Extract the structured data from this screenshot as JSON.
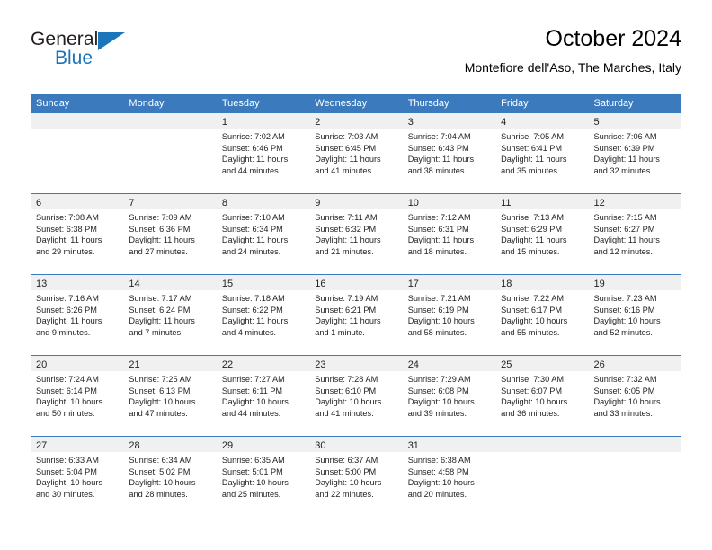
{
  "brand": {
    "name_top": "General",
    "name_bottom": "Blue",
    "triangle_icon": "brand-triangle-icon",
    "color_dark": "#231f20",
    "color_blue": "#1b75bb"
  },
  "header": {
    "title": "October 2024",
    "subtitle": "Montefiore dell'Aso, The Marches, Italy"
  },
  "theme": {
    "header_blue": "#3a7abd",
    "daynum_band": "#f0f0f0",
    "text": "#222222"
  },
  "calendar": {
    "weekday_headers": [
      "Sunday",
      "Monday",
      "Tuesday",
      "Wednesday",
      "Thursday",
      "Friday",
      "Saturday"
    ],
    "weeks": [
      [
        {
          "day": "",
          "lines": []
        },
        {
          "day": "",
          "lines": []
        },
        {
          "day": "1",
          "lines": [
            "Sunrise: 7:02 AM",
            "Sunset: 6:46 PM",
            "Daylight: 11 hours",
            "and 44 minutes."
          ]
        },
        {
          "day": "2",
          "lines": [
            "Sunrise: 7:03 AM",
            "Sunset: 6:45 PM",
            "Daylight: 11 hours",
            "and 41 minutes."
          ]
        },
        {
          "day": "3",
          "lines": [
            "Sunrise: 7:04 AM",
            "Sunset: 6:43 PM",
            "Daylight: 11 hours",
            "and 38 minutes."
          ]
        },
        {
          "day": "4",
          "lines": [
            "Sunrise: 7:05 AM",
            "Sunset: 6:41 PM",
            "Daylight: 11 hours",
            "and 35 minutes."
          ]
        },
        {
          "day": "5",
          "lines": [
            "Sunrise: 7:06 AM",
            "Sunset: 6:39 PM",
            "Daylight: 11 hours",
            "and 32 minutes."
          ]
        }
      ],
      [
        {
          "day": "6",
          "lines": [
            "Sunrise: 7:08 AM",
            "Sunset: 6:38 PM",
            "Daylight: 11 hours",
            "and 29 minutes."
          ]
        },
        {
          "day": "7",
          "lines": [
            "Sunrise: 7:09 AM",
            "Sunset: 6:36 PM",
            "Daylight: 11 hours",
            "and 27 minutes."
          ]
        },
        {
          "day": "8",
          "lines": [
            "Sunrise: 7:10 AM",
            "Sunset: 6:34 PM",
            "Daylight: 11 hours",
            "and 24 minutes."
          ]
        },
        {
          "day": "9",
          "lines": [
            "Sunrise: 7:11 AM",
            "Sunset: 6:32 PM",
            "Daylight: 11 hours",
            "and 21 minutes."
          ]
        },
        {
          "day": "10",
          "lines": [
            "Sunrise: 7:12 AM",
            "Sunset: 6:31 PM",
            "Daylight: 11 hours",
            "and 18 minutes."
          ]
        },
        {
          "day": "11",
          "lines": [
            "Sunrise: 7:13 AM",
            "Sunset: 6:29 PM",
            "Daylight: 11 hours",
            "and 15 minutes."
          ]
        },
        {
          "day": "12",
          "lines": [
            "Sunrise: 7:15 AM",
            "Sunset: 6:27 PM",
            "Daylight: 11 hours",
            "and 12 minutes."
          ]
        }
      ],
      [
        {
          "day": "13",
          "lines": [
            "Sunrise: 7:16 AM",
            "Sunset: 6:26 PM",
            "Daylight: 11 hours",
            "and 9 minutes."
          ]
        },
        {
          "day": "14",
          "lines": [
            "Sunrise: 7:17 AM",
            "Sunset: 6:24 PM",
            "Daylight: 11 hours",
            "and 7 minutes."
          ]
        },
        {
          "day": "15",
          "lines": [
            "Sunrise: 7:18 AM",
            "Sunset: 6:22 PM",
            "Daylight: 11 hours",
            "and 4 minutes."
          ]
        },
        {
          "day": "16",
          "lines": [
            "Sunrise: 7:19 AM",
            "Sunset: 6:21 PM",
            "Daylight: 11 hours",
            "and 1 minute."
          ]
        },
        {
          "day": "17",
          "lines": [
            "Sunrise: 7:21 AM",
            "Sunset: 6:19 PM",
            "Daylight: 10 hours",
            "and 58 minutes."
          ]
        },
        {
          "day": "18",
          "lines": [
            "Sunrise: 7:22 AM",
            "Sunset: 6:17 PM",
            "Daylight: 10 hours",
            "and 55 minutes."
          ]
        },
        {
          "day": "19",
          "lines": [
            "Sunrise: 7:23 AM",
            "Sunset: 6:16 PM",
            "Daylight: 10 hours",
            "and 52 minutes."
          ]
        }
      ],
      [
        {
          "day": "20",
          "lines": [
            "Sunrise: 7:24 AM",
            "Sunset: 6:14 PM",
            "Daylight: 10 hours",
            "and 50 minutes."
          ]
        },
        {
          "day": "21",
          "lines": [
            "Sunrise: 7:25 AM",
            "Sunset: 6:13 PM",
            "Daylight: 10 hours",
            "and 47 minutes."
          ]
        },
        {
          "day": "22",
          "lines": [
            "Sunrise: 7:27 AM",
            "Sunset: 6:11 PM",
            "Daylight: 10 hours",
            "and 44 minutes."
          ]
        },
        {
          "day": "23",
          "lines": [
            "Sunrise: 7:28 AM",
            "Sunset: 6:10 PM",
            "Daylight: 10 hours",
            "and 41 minutes."
          ]
        },
        {
          "day": "24",
          "lines": [
            "Sunrise: 7:29 AM",
            "Sunset: 6:08 PM",
            "Daylight: 10 hours",
            "and 39 minutes."
          ]
        },
        {
          "day": "25",
          "lines": [
            "Sunrise: 7:30 AM",
            "Sunset: 6:07 PM",
            "Daylight: 10 hours",
            "and 36 minutes."
          ]
        },
        {
          "day": "26",
          "lines": [
            "Sunrise: 7:32 AM",
            "Sunset: 6:05 PM",
            "Daylight: 10 hours",
            "and 33 minutes."
          ]
        }
      ],
      [
        {
          "day": "27",
          "lines": [
            "Sunrise: 6:33 AM",
            "Sunset: 5:04 PM",
            "Daylight: 10 hours",
            "and 30 minutes."
          ]
        },
        {
          "day": "28",
          "lines": [
            "Sunrise: 6:34 AM",
            "Sunset: 5:02 PM",
            "Daylight: 10 hours",
            "and 28 minutes."
          ]
        },
        {
          "day": "29",
          "lines": [
            "Sunrise: 6:35 AM",
            "Sunset: 5:01 PM",
            "Daylight: 10 hours",
            "and 25 minutes."
          ]
        },
        {
          "day": "30",
          "lines": [
            "Sunrise: 6:37 AM",
            "Sunset: 5:00 PM",
            "Daylight: 10 hours",
            "and 22 minutes."
          ]
        },
        {
          "day": "31",
          "lines": [
            "Sunrise: 6:38 AM",
            "Sunset: 4:58 PM",
            "Daylight: 10 hours",
            "and 20 minutes."
          ]
        },
        {
          "day": "",
          "lines": []
        },
        {
          "day": "",
          "lines": []
        }
      ]
    ]
  }
}
